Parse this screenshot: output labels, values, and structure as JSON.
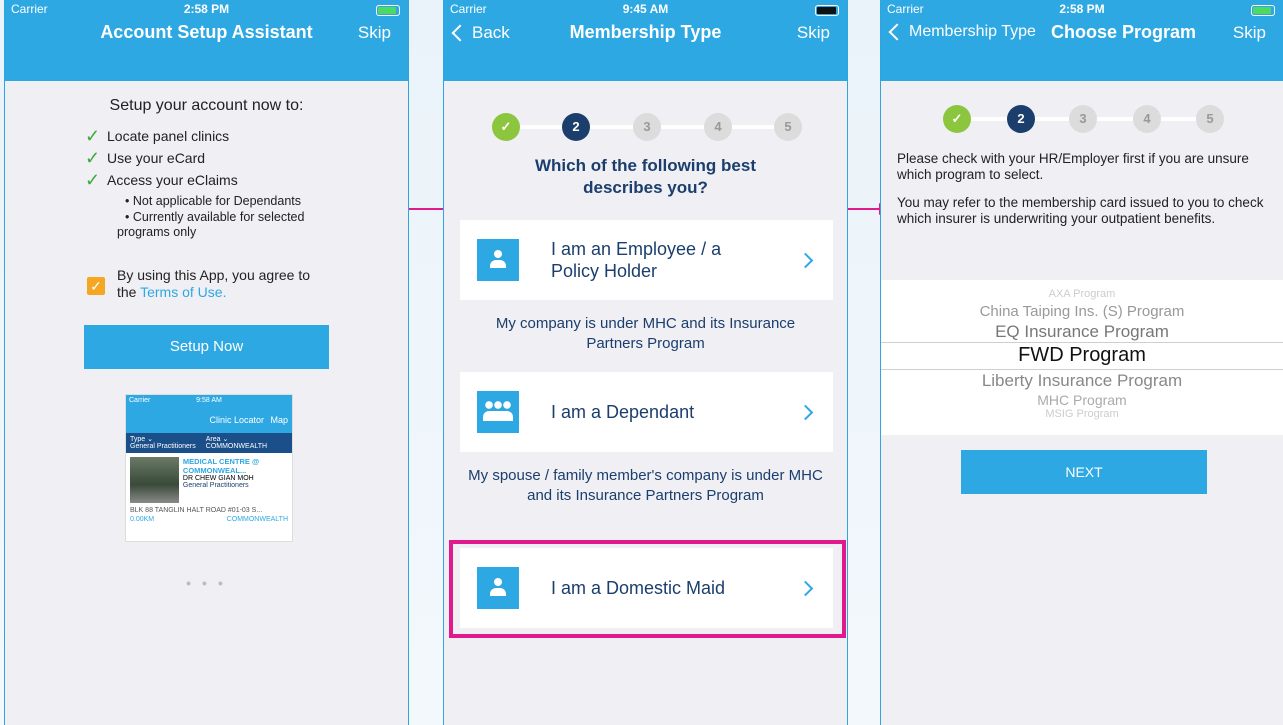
{
  "colors": {
    "accent": "#2ea8e3",
    "navy": "#1b3e6d",
    "highlight": "#e0198c",
    "done": "#8cc63f"
  },
  "panel1": {
    "status": {
      "carrier": "Carrier",
      "time": "2:58 PM"
    },
    "nav": {
      "title": "Account Setup Assistant",
      "skip": "Skip"
    },
    "lead": "Setup your account now to:",
    "bullets": [
      "Locate panel clinics",
      "Use your eCard",
      "Access your eClaims"
    ],
    "subbullets": [
      "• Not applicable for Dependants",
      "• Currently available for selected",
      "programs only"
    ],
    "agree_text": "By using this App, you agree to",
    "agree_the": "the",
    "terms_link": "Terms of Use.",
    "setup_button": "Setup Now",
    "preview": {
      "carrier": "Carrier",
      "time": "9:58 AM",
      "title": "Clinic Locator",
      "map": "Map",
      "type_label": "Type ⌄",
      "type_value": "General Practitioners",
      "area_label": "Area ⌄",
      "area_value": "COMMONWEALTH",
      "clinic_name": "MEDICAL CENTRE @ COMMONWEAL...",
      "doctor": "DR CHEW GIAN MOH",
      "category": "General Practitioners",
      "address": "BLK 88 TANGLIN HALT ROAD #01-03 S...",
      "distance": "0.00KM",
      "area": "COMMONWEALTH"
    }
  },
  "panel2": {
    "status": {
      "carrier": "Carrier",
      "time": "9:45 AM"
    },
    "nav": {
      "back": "Back",
      "title": "Membership Type",
      "skip": "Skip"
    },
    "steps": [
      "✓",
      "2",
      "3",
      "4",
      "5"
    ],
    "question": "Which of the following best describes you?",
    "options": [
      {
        "label": "I am an Employee / a Policy Holder",
        "note": "My company is under MHC and its Insurance Partners Program"
      },
      {
        "label": "I am a Dependant",
        "note": "My spouse / family member's company is under MHC and its Insurance Partners Program"
      },
      {
        "label": "I am a Domestic Maid",
        "note": ""
      }
    ]
  },
  "panel3": {
    "status": {
      "carrier": "Carrier",
      "time": "2:58 PM"
    },
    "nav": {
      "back": "Membership Type",
      "title": "Choose Program",
      "skip": "Skip"
    },
    "steps": [
      "✓",
      "2",
      "3",
      "4",
      "5"
    ],
    "text1": "Please check with your HR/Employer first if you are unsure which program to select.",
    "text2": "You may refer to the membership card issued to you to check which insurer is underwriting your outpatient benefits.",
    "picker_options": [
      "AXA Program",
      "China Taiping Ins. (S) Program",
      "EQ Insurance Program",
      "FWD Program",
      "Liberty Insurance Program",
      "MHC Program",
      "MSIG Program"
    ],
    "selected": "FWD Program",
    "next_button": "NEXT"
  }
}
